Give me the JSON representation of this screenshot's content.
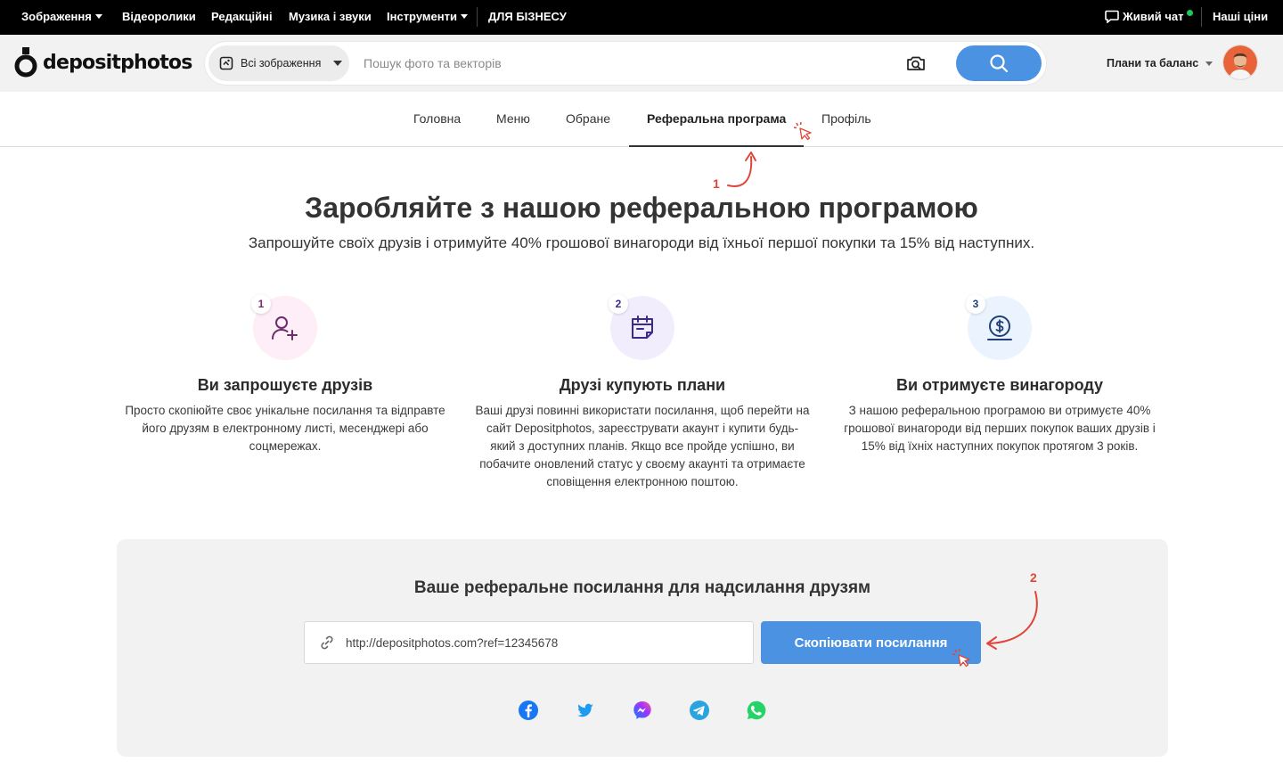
{
  "topnav": {
    "items": [
      {
        "label": "Зображення",
        "caret": true
      },
      {
        "label": "Відеоролики",
        "caret": false
      },
      {
        "label": "Редакційні",
        "caret": false
      },
      {
        "label": "Музика і звуки",
        "caret": false
      },
      {
        "label": "Інструменти",
        "caret": true
      },
      {
        "label": "ДЛЯ БІЗНЕСУ",
        "caret": false
      }
    ],
    "live_chat": "Живий чат",
    "pricing": "Наші ціни"
  },
  "header": {
    "logo_text": "depositphotos",
    "scope_label": "Всі зображення",
    "search_placeholder": "Пошук фото та векторів",
    "plans_label": "Плани та баланс"
  },
  "tabs": [
    {
      "label": "Головна"
    },
    {
      "label": "Меню"
    },
    {
      "label": "Обране"
    },
    {
      "label": "Реферальна програма",
      "active": true
    },
    {
      "label": "Профіль"
    }
  ],
  "hero": {
    "title": "Заробляйте з нашою реферальною програмою",
    "subtitle": "Запрошуйте своїх друзів і отримуйте 40% грошової винагороди від їхньої першої покупки та 15% від наступних."
  },
  "steps": [
    {
      "num": "1",
      "icon": "add-user-icon",
      "title": "Ви запрошуєте друзів",
      "text": "Просто скопіюйте своє унікальне посилання та відправте його друзям в електронному листі, месенджері або соцмережах."
    },
    {
      "num": "2",
      "icon": "calendar-note-icon",
      "title": "Друзі купують плани",
      "text": "Ваші друзі повинні використати посилання, щоб перейти на сайт Depositphotos, зареєструвати акаунт і купити будь-який з доступних планів. Якщо все пройде успішно, ви побачите оновлений статус у своєму акаунті та отримаєте сповіщення електронною поштою."
    },
    {
      "num": "3",
      "icon": "dollar-coin-icon",
      "title": "Ви отримуєте винагороду",
      "text": "З нашою реферальною програмою ви отримуєте 40% грошової винагороди від перших покупок ваших друзів і 15% від їхніх наступних покупок протягом 3 років."
    }
  ],
  "referral": {
    "title": "Ваше реферальне посилання для надсилання друзям",
    "link_value": "http://depositphotos.com?ref=12345678",
    "copy_label": "Скопіювати посилання",
    "socials": [
      "facebook-icon",
      "twitter-icon",
      "messenger-icon",
      "telegram-icon",
      "whatsapp-icon"
    ]
  },
  "annotations": {
    "first": "1",
    "second": "2"
  },
  "colors": {
    "accent": "#4b93e2",
    "annotation": "#e0453a",
    "step1_bg": "#fdeef7",
    "step2_bg": "#f1edfd",
    "step3_bg": "#ebf4fe"
  }
}
